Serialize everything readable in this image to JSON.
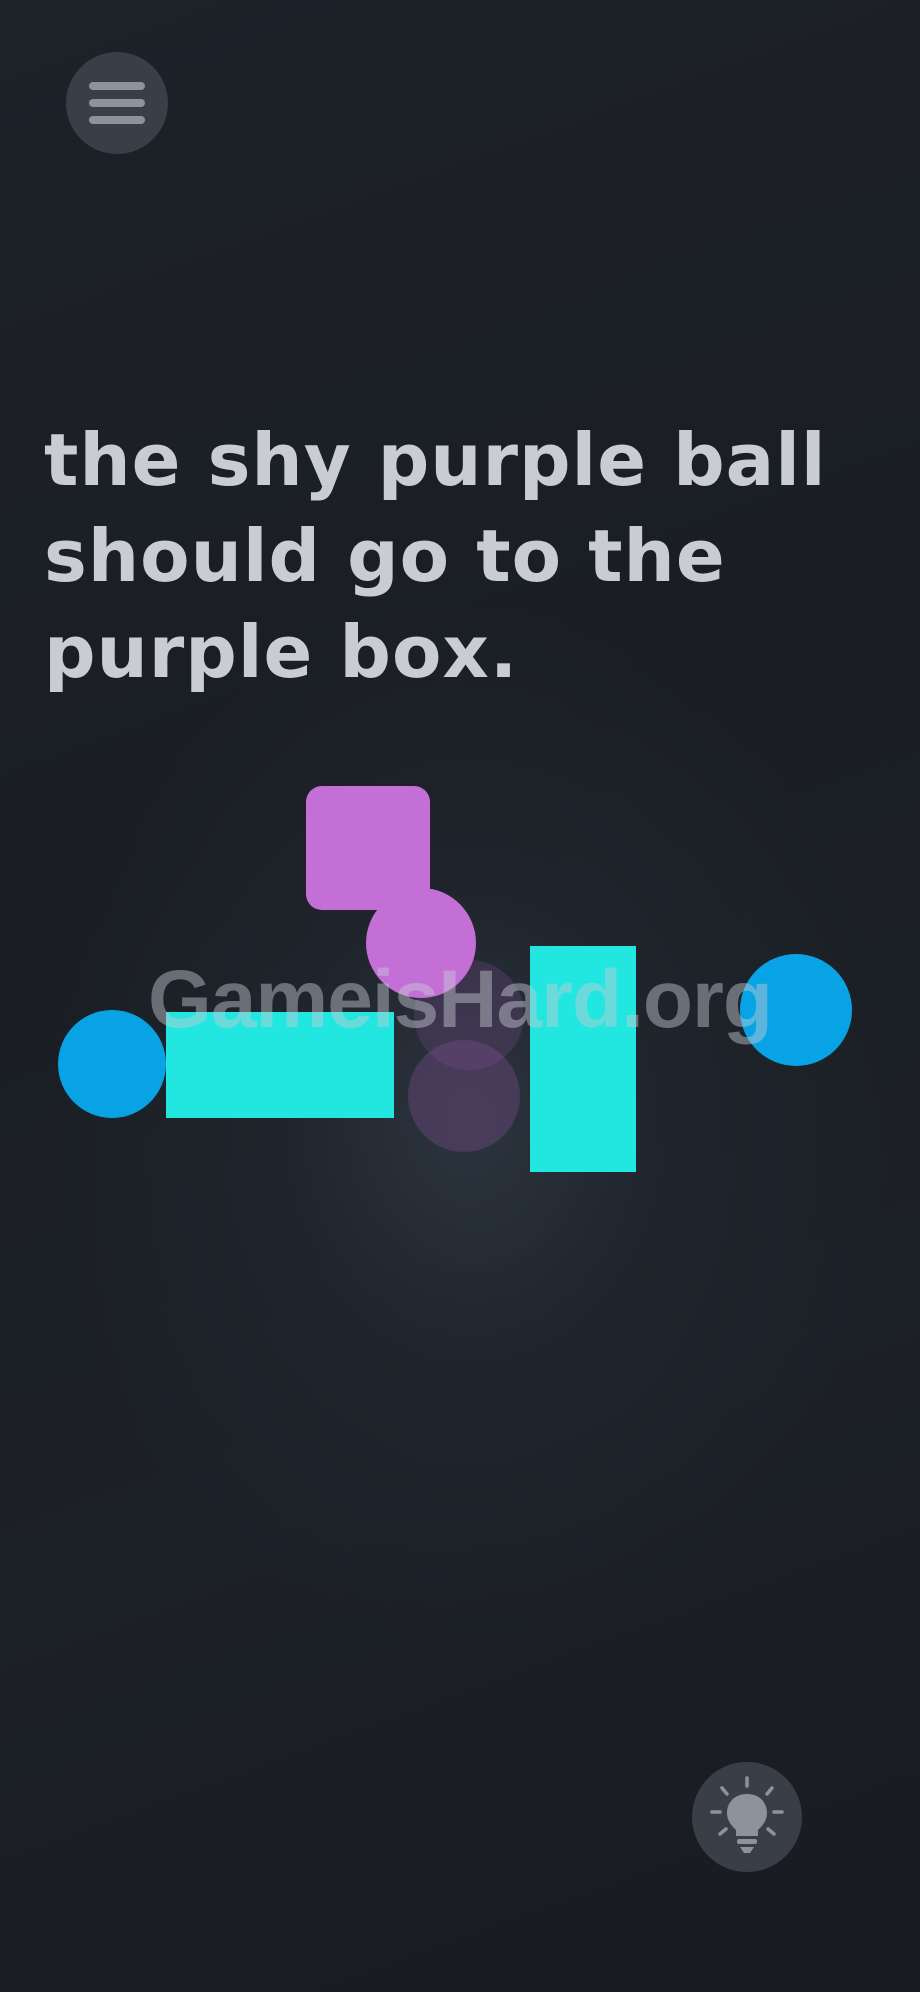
{
  "menu": {
    "icon": "hamburger-menu-icon"
  },
  "level": {
    "instruction": "the shy purple ball should go to the purple box."
  },
  "watermark": {
    "text": "GameisHard.org"
  },
  "hint": {
    "icon": "lightbulb-icon"
  },
  "colors": {
    "background": "#1b1f25",
    "purple": "#c46fd6",
    "cyan": "#22e6e0",
    "blue": "#07a3e4",
    "text": "#c9ccd1",
    "button": "#3a3f47"
  }
}
